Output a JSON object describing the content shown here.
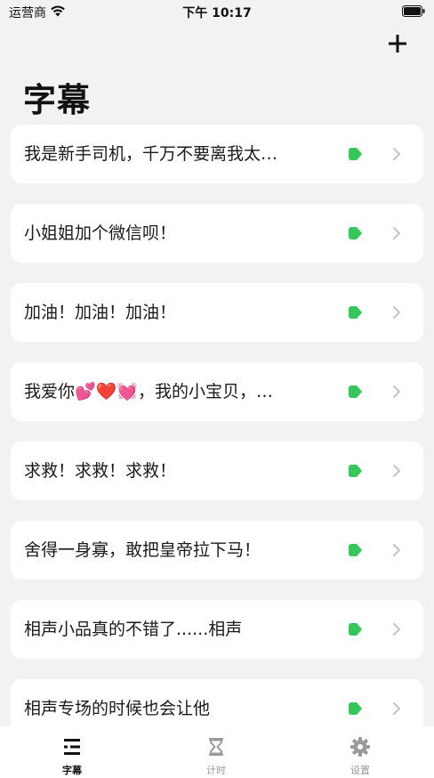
{
  "status_bar": {
    "carrier": "运营商",
    "time": "下午 10:17"
  },
  "header": {
    "title": "字幕",
    "add_icon": "plus-icon"
  },
  "colors": {
    "accent_green": "#34c759",
    "background": "#f2f2f2",
    "card": "#ffffff",
    "chevron": "#c4c4c4",
    "tab_inactive": "#9a9a9a"
  },
  "items": [
    {
      "text": "我是新手司机，千万不要离我太…"
    },
    {
      "text": "小姐姐加个微信呗！"
    },
    {
      "text": "加油！加油！加油！"
    },
    {
      "text": "我爱你💕❤️💓，我的小宝贝，…"
    },
    {
      "text": "求救！求救！求救！"
    },
    {
      "text": "舍得一身寡，敢把皇帝拉下马！"
    },
    {
      "text": "相声小品真的不错了......相声"
    },
    {
      "text": "相声专场的时候也会让他"
    }
  ],
  "tabs": [
    {
      "label": "字幕",
      "icon": "list-icon",
      "active": true
    },
    {
      "label": "计时",
      "icon": "hourglass-icon",
      "active": false
    },
    {
      "label": "设置",
      "icon": "gear-icon",
      "active": false
    }
  ]
}
